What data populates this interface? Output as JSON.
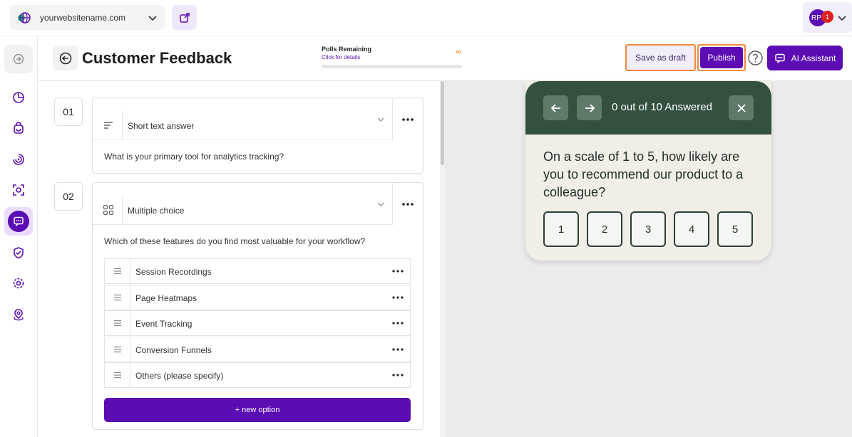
{
  "topbar": {
    "site_name": "yourwebsitename.com",
    "user_initials": "RP",
    "notification_count": "1"
  },
  "header": {
    "title": "Customer Feedback",
    "polls_label": "Polls Remaining",
    "polls_link": "Click for details",
    "polls_value": "∞",
    "draft_label": "Save as draft",
    "publish_label": "Publish",
    "ai_label": "AI Assistant"
  },
  "questions": [
    {
      "number": "01",
      "type": "Short text answer",
      "text": "What is your primary tool for analytics tracking?"
    },
    {
      "number": "02",
      "type": "Multiple choice",
      "text": "Which of these features do you find most valuable for your workflow?",
      "options": [
        "Session Recordings",
        "Page Heatmaps",
        "Event Tracking",
        "Conversion Funnels",
        "Others (please specify)"
      ],
      "new_option_label": "+ new option"
    }
  ],
  "preview": {
    "progress": "0 out of 10 Answered",
    "question": "On a scale of 1 to 5, how likely are you to recommend our product to a colleague?",
    "scale": [
      "1",
      "2",
      "3",
      "4",
      "5"
    ]
  },
  "colors": {
    "brand": "#5b0db3",
    "widget_header": "#34513f",
    "highlight_border": "#f08a3c"
  }
}
